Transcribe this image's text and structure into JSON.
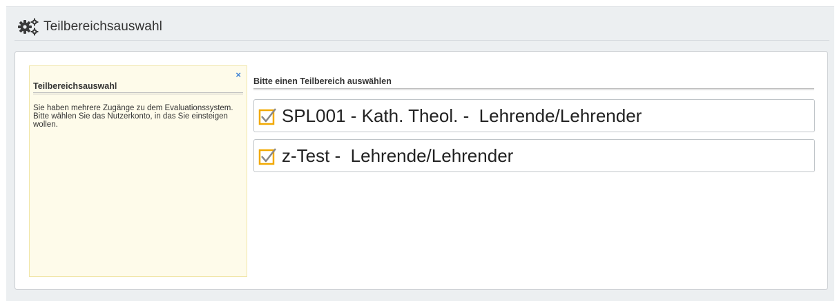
{
  "header": {
    "icon": "gears-icon",
    "title": "Teilbereichsauswahl"
  },
  "info_box": {
    "close_symbol": "×",
    "title": "Teilbereichsauswahl",
    "text": "Sie haben mehrere Zugänge zu dem Evaluationssystem. Bitte wählen Sie das Nutzerkonto, in das Sie einsteigen wollen."
  },
  "selection": {
    "heading": "Bitte einen Teilbereich auswählen",
    "options": [
      {
        "icon": "checkbox-checked-icon",
        "label": "SPL001 - Kath. Theol. -  Lehrende/Lehrender"
      },
      {
        "icon": "checkbox-checked-icon",
        "label": "z-Test -  Lehrende/Lehrender"
      }
    ]
  },
  "colors": {
    "background": "#eceff1",
    "info_box_bg": "#fefbea",
    "close_icon": "#3a7fd4",
    "check_mark": "#f2a900"
  }
}
